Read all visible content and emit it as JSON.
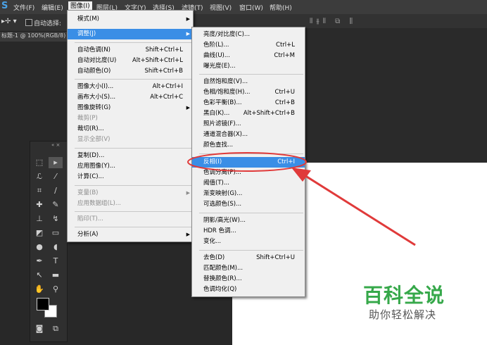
{
  "app": {
    "logo": "S"
  },
  "menubar": [
    "文件(F)",
    "编辑(E)",
    "图像(I)",
    "图层(L)",
    "文字(Y)",
    "选择(S)",
    "滤镜(T)",
    "视图(V)",
    "窗口(W)",
    "帮助(H)"
  ],
  "options": {
    "auto_select": "自动选择:"
  },
  "document": {
    "tab": "标题-1 @ 100%(RGB/8)"
  },
  "image_menu": {
    "items": [
      {
        "label": "模式(M)",
        "shortcut": "",
        "sub": true
      },
      {
        "label": "调整(J)",
        "shortcut": "",
        "sub": true,
        "hl": true
      },
      {
        "label": "自动色调(N)",
        "shortcut": "Shift+Ctrl+L"
      },
      {
        "label": "自动对比度(U)",
        "shortcut": "Alt+Shift+Ctrl+L"
      },
      {
        "label": "自动颜色(O)",
        "shortcut": "Shift+Ctrl+B"
      },
      {
        "label": "图像大小(I)...",
        "shortcut": "Alt+Ctrl+I"
      },
      {
        "label": "画布大小(S)...",
        "shortcut": "Alt+Ctrl+C"
      },
      {
        "label": "图像旋转(G)",
        "shortcut": "",
        "sub": true
      },
      {
        "label": "裁剪(P)",
        "shortcut": "",
        "dis": true
      },
      {
        "label": "裁切(R)...",
        "shortcut": ""
      },
      {
        "label": "显示全部(V)",
        "shortcut": "",
        "dis": true
      },
      {
        "label": "复制(D)...",
        "shortcut": ""
      },
      {
        "label": "应用图像(Y)...",
        "shortcut": ""
      },
      {
        "label": "计算(C)...",
        "shortcut": ""
      },
      {
        "label": "变量(B)",
        "shortcut": "",
        "sub": true,
        "dis": true
      },
      {
        "label": "应用数据组(L)...",
        "shortcut": "",
        "dis": true
      },
      {
        "label": "陷印(T)...",
        "shortcut": "",
        "dis": true
      },
      {
        "label": "分析(A)",
        "shortcut": "",
        "sub": true
      }
    ]
  },
  "adjust_menu": {
    "items": [
      {
        "label": "亮度/对比度(C)...",
        "shortcut": ""
      },
      {
        "label": "色阶(L)...",
        "shortcut": "Ctrl+L"
      },
      {
        "label": "曲线(U)...",
        "shortcut": "Ctrl+M"
      },
      {
        "label": "曝光度(E)...",
        "shortcut": ""
      },
      {
        "label": "自然饱和度(V)...",
        "shortcut": ""
      },
      {
        "label": "色相/饱和度(H)...",
        "shortcut": "Ctrl+U"
      },
      {
        "label": "色彩平衡(B)...",
        "shortcut": "Ctrl+B"
      },
      {
        "label": "黑白(K)...",
        "shortcut": "Alt+Shift+Ctrl+B"
      },
      {
        "label": "照片滤镜(F)...",
        "shortcut": ""
      },
      {
        "label": "通道混合器(X)...",
        "shortcut": ""
      },
      {
        "label": "颜色查找...",
        "shortcut": ""
      },
      {
        "label": "反相(I)",
        "shortcut": "Ctrl+I",
        "hl": true
      },
      {
        "label": "色调分离(P)...",
        "shortcut": ""
      },
      {
        "label": "阈值(T)...",
        "shortcut": ""
      },
      {
        "label": "渐变映射(G)...",
        "shortcut": ""
      },
      {
        "label": "可选颜色(S)...",
        "shortcut": ""
      },
      {
        "label": "阴影/高光(W)...",
        "shortcut": ""
      },
      {
        "label": "HDR 色调...",
        "shortcut": ""
      },
      {
        "label": "变化...",
        "shortcut": ""
      },
      {
        "label": "去色(D)",
        "shortcut": "Shift+Ctrl+U"
      },
      {
        "label": "匹配颜色(M)...",
        "shortcut": ""
      },
      {
        "label": "替换颜色(R)...",
        "shortcut": ""
      },
      {
        "label": "色调均化(Q)",
        "shortcut": ""
      }
    ]
  },
  "watermark": {
    "brand": "百科全说",
    "slogan": "助你轻松解决"
  },
  "colors": {
    "highlight": "#3a8ee6",
    "annotation": "#e03a3a",
    "brand_green": "#36a84a"
  }
}
